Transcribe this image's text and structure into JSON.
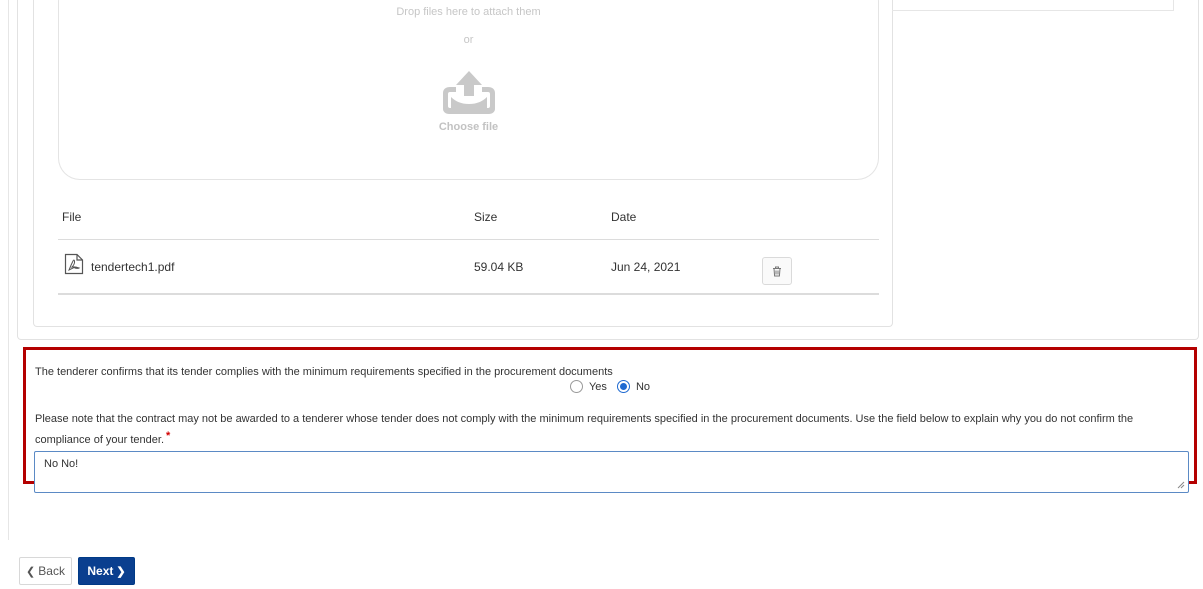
{
  "upload": {
    "drop_text": "Drop files here to attach them",
    "or_text": "or",
    "choose_label": "Choose file",
    "icon": "upload-icon"
  },
  "files": {
    "headers": {
      "file": "File",
      "size": "Size",
      "date": "Date"
    },
    "rows": [
      {
        "name": "tendertech1.pdf",
        "size": "59.04 KB",
        "date": "Jun 24, 2021",
        "icon": "pdf-icon"
      }
    ]
  },
  "compliance": {
    "question": "The tenderer confirms that its tender complies with the minimum requirements specified in the procurement documents",
    "options": [
      "Yes",
      "No"
    ],
    "selected": "No",
    "note": "Please note that the contract may not be awarded to a tenderer whose tender does not comply with the minimum requirements specified in the procurement documents. Use the field below to explain why you do not confirm the compliance of your tender.",
    "required_marker": "*",
    "explanation_value": "No No!"
  },
  "nav": {
    "back_label": "Back",
    "next_label": "Next"
  },
  "colors": {
    "highlight_border": "#b40000",
    "primary_button": "#0a3f8f",
    "radio_accent": "#1f6ad1",
    "required": "#d20000"
  }
}
